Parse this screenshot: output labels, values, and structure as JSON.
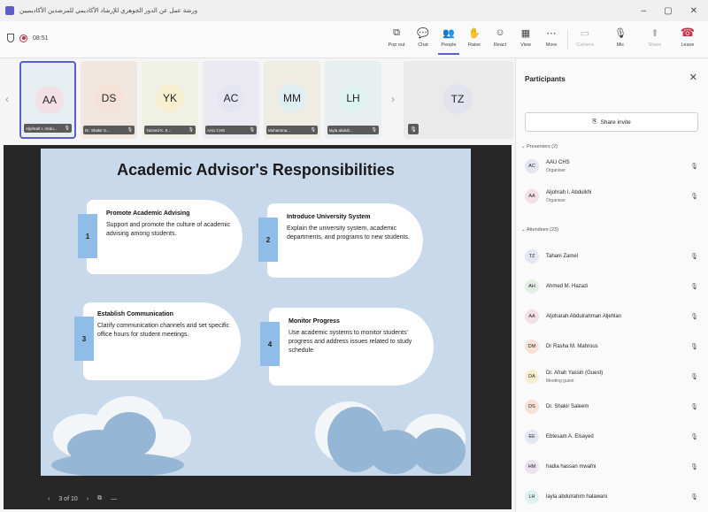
{
  "window": {
    "title": "ورشة عمل عن الدور الجوهري للإرشاد الأكاديمي للمرشدين الأكاديميين",
    "controls": [
      "–",
      "▢",
      "✕"
    ]
  },
  "toolbar": {
    "meeting_time": "08:51",
    "buttons": [
      {
        "label": "Pop out",
        "icon": "popout-icon",
        "glyph": "⧉"
      },
      {
        "label": "Chat",
        "icon": "chat-icon",
        "glyph": "💬"
      },
      {
        "label": "People",
        "icon": "people-icon",
        "glyph": "👥"
      },
      {
        "label": "Raise",
        "icon": "raise-hand-icon",
        "glyph": "✋"
      },
      {
        "label": "React",
        "icon": "react-icon",
        "glyph": "☺"
      },
      {
        "label": "View",
        "icon": "view-icon",
        "glyph": "▦"
      },
      {
        "label": "More",
        "icon": "more-icon",
        "glyph": "⋯"
      },
      {
        "label": "Camera",
        "icon": "camera-icon",
        "glyph": "▭"
      },
      {
        "label": "Mic",
        "icon": "mic-icon",
        "glyph": "🎙"
      },
      {
        "label": "Share",
        "icon": "share-icon",
        "glyph": "⬆"
      },
      {
        "label": "Leave",
        "icon": "leave-icon",
        "glyph": "☎"
      }
    ]
  },
  "thumbnails": [
    {
      "initials": "AA",
      "name": "Aljohrah I. Abdu...",
      "color": "#f3dfe6",
      "bg": "#e6eef2",
      "selected": true
    },
    {
      "initials": "DS",
      "name": "Dr. Shakir S...",
      "color": "#f6e2d6",
      "bg": "#f1e7de",
      "selected": false
    },
    {
      "initials": "YK",
      "name": "Yazeed K. K...",
      "color": "#f7efcf",
      "bg": "#eef1e4",
      "selected": false
    },
    {
      "initials": "AC",
      "name": "AAU CHS",
      "color": "#e6e6f3",
      "bg": "#ebeaf2",
      "selected": false
    },
    {
      "initials": "MM",
      "name": "Mohamma...",
      "color": "#dfeef0",
      "bg": "#efece4",
      "selected": false
    },
    {
      "initials": "LH",
      "name": "layla abdulr...",
      "color": "#def2ef",
      "bg": "#e9eff0",
      "selected": false
    }
  ],
  "big_tile": {
    "initials": "TZ"
  },
  "slide": {
    "title": "Academic Advisor's Responsibilities",
    "cards": [
      {
        "num": "1",
        "title": "Promote Academic Advising",
        "body": "Support and promote the culture of academic advising among students."
      },
      {
        "num": "2",
        "title": "Introduce University System",
        "body": "Explain the university system, academic departments, and programs to new students."
      },
      {
        "num": "3",
        "title": "Establish Communication",
        "body": "Clarify communication channels and set specific office hours for student meetings."
      },
      {
        "num": "4",
        "title": "Monitor Progress",
        "body": "Use academic systems to monitor students' progress and address issues related to study schedule"
      }
    ],
    "page_indicator": "3 of 10"
  },
  "panel": {
    "title": "Participants",
    "share_label": "Share invite",
    "presenters_label": "Presenters (2)",
    "attendees_label": "Attendees (23)",
    "presenters": [
      {
        "initials": "AC",
        "name": "AAU CHS",
        "role": "Organiser",
        "color": "#e6e6f3"
      },
      {
        "initials": "AA",
        "name": "Aljohrah I. Abdulkhi",
        "role": "Organiser",
        "color": "#f3dfe6"
      }
    ],
    "attendees": [
      {
        "initials": "TZ",
        "name": "Tahani Zamel",
        "role": "",
        "color": "#e6e6f3"
      },
      {
        "initials": "AH",
        "name": "Ahmed M. Hazazi",
        "role": "",
        "color": "#e4eee4"
      },
      {
        "initials": "AA",
        "name": "Aljoharah Abdulrahman Aljehlan",
        "role": "",
        "color": "#f3dfe6"
      },
      {
        "initials": "DM",
        "name": "Dr Rasha M. Mahrous",
        "role": "",
        "color": "#f6e2d6"
      },
      {
        "initials": "DA",
        "name": "Dr. Afrah Yassin (Guest)",
        "role": "Meeting guest",
        "color": "#f7efcf"
      },
      {
        "initials": "DS",
        "name": "Dr. Shakir Saleem",
        "role": "",
        "color": "#f6e2d6"
      },
      {
        "initials": "EE",
        "name": "Ebtesam A. Elsayed",
        "role": "",
        "color": "#e3e8f3"
      },
      {
        "initials": "HM",
        "name": "hadia hassan mwafni",
        "role": "",
        "color": "#ece1f1"
      },
      {
        "initials": "LH",
        "name": "layla abdulrahim halawani",
        "role": "",
        "color": "#def2ef"
      }
    ]
  }
}
